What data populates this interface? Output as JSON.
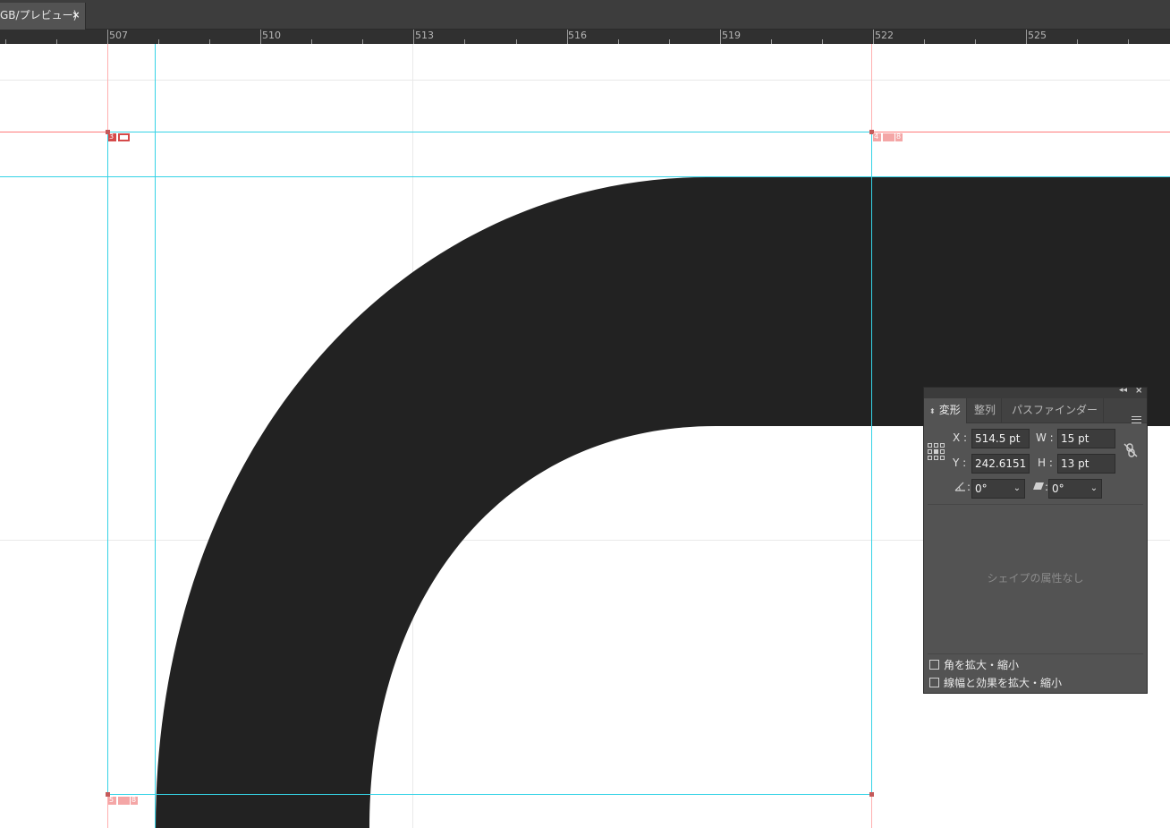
{
  "document_tab": {
    "title": "GB/プレビュー)",
    "close_label": "×"
  },
  "ruler": {
    "labels": [
      "507",
      "510",
      "513",
      "516",
      "519",
      "522",
      "525"
    ]
  },
  "canvas": {
    "anchor_labels": {
      "top_left": "3",
      "top_right": "4",
      "top_right_extra": "8",
      "bottom_left": "5",
      "bottom_left_extra": "8"
    },
    "shape_fill": "#222222",
    "guide_color": "#35d3e6",
    "margin_color": "#ff7a7a"
  },
  "transform_panel": {
    "tabs": [
      {
        "label": "変形",
        "active": true
      },
      {
        "label": "整列",
        "active": false
      },
      {
        "label": "パスファインダー",
        "active": false
      }
    ],
    "x_label": "X :",
    "x_value": "514.5 pt",
    "y_label": "Y :",
    "y_value": "242.6151",
    "w_label": "W :",
    "w_value": "15 pt",
    "h_label": "H :",
    "h_value": "13 pt",
    "rotate_label": ":",
    "rotate_value": "0°",
    "shear_label": ":",
    "shear_value": "0°",
    "no_attributes": "シェイプの属性なし",
    "scale_corners_label": "角を拡大・縮小",
    "scale_strokes_label": "線幅と効果を拡大・縮小",
    "icons": [
      "reference-point-grid-icon",
      "link-proportions-icon",
      "rotate-angle-icon",
      "shear-icon",
      "panel-menu-icon",
      "collapse-icon",
      "close-icon"
    ]
  }
}
